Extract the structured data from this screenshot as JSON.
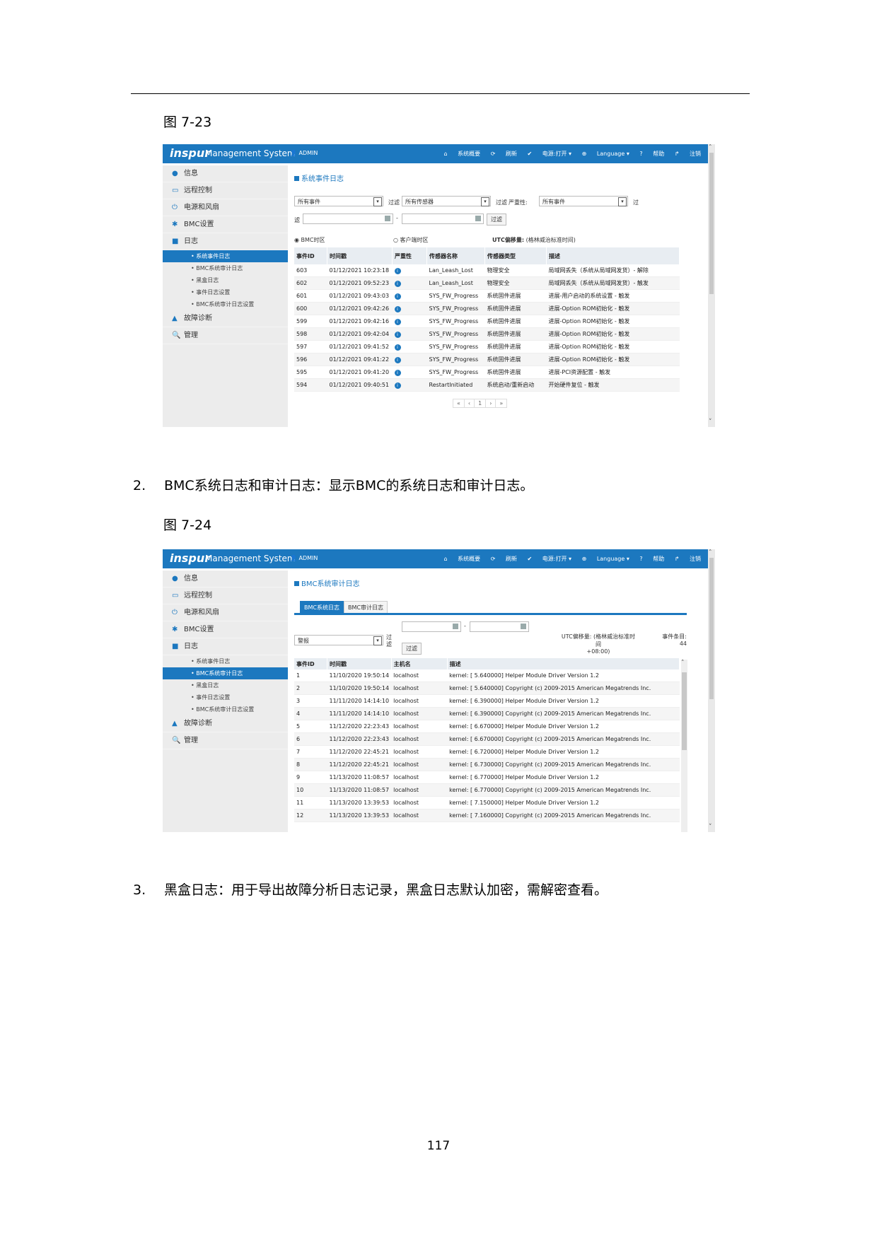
{
  "doc": {
    "fig1_label": "图 7-23",
    "fig2_label": "图 7-24",
    "item2_num": "2.",
    "item2_text": "BMC系统日志和审计日志：显示BMC的系统日志和审计日志。",
    "item3_num": "3.",
    "item3_text": "黑盒日志：用于导出故障分析日志记录，黑盒日志默认加密，需解密查看。",
    "page_number": "117"
  },
  "app": {
    "logo": "inspur",
    "title": "Management System",
    "user": "ADMIN",
    "nav": [
      "系统概要",
      "刷新",
      "电源:打开 ▾",
      "Language ▾",
      "帮助",
      "注销"
    ],
    "sidebar": [
      "信息",
      "远程控制",
      "电源和风扇",
      "BMC设置",
      "日志",
      "故障诊断",
      "管理"
    ],
    "log_subitems": [
      "系统事件日志",
      "BMC系统审计日志",
      "黑盒日志",
      "事件日志设置",
      "BMC系统审计日志设置"
    ]
  },
  "fig1": {
    "section_title": "系统事件日志",
    "filter1": "所有事件",
    "filter_label1": "过滤",
    "filter2": "所有传感器",
    "filter_label2": "过滤",
    "severity_label": "严重性:",
    "filter3": "所有事件",
    "filter_label3": "过",
    "filter_label3b": "滤",
    "dash": "-",
    "filter_button": "过滤",
    "radio1": "BMC时区",
    "radio2": "客户端时区",
    "utc_label": "UTC偏移量:",
    "utc_note": "(格林威治标准时间)",
    "columns": [
      "事件ID",
      "时间戳",
      "严重性",
      "传感器名称",
      "传感器类型",
      "描述"
    ],
    "rows": [
      [
        "603",
        "01/12/2021 10:23:18",
        "i",
        "Lan_Leash_Lost",
        "物理安全",
        "局域网丢失（系统从局域网发货）- 解除"
      ],
      [
        "602",
        "01/12/2021 09:52:23",
        "i",
        "Lan_Leash_Lost",
        "物理安全",
        "局域网丢失（系统从局域网发货）- 触发"
      ],
      [
        "601",
        "01/12/2021 09:43:03",
        "i",
        "SYS_FW_Progress",
        "系统固件进展",
        "进展-用户启动的系统设置 - 触发"
      ],
      [
        "600",
        "01/12/2021 09:42:26",
        "i",
        "SYS_FW_Progress",
        "系统固件进展",
        "进展-Option ROM初始化 - 触发"
      ],
      [
        "599",
        "01/12/2021 09:42:16",
        "i",
        "SYS_FW_Progress",
        "系统固件进展",
        "进展-Option ROM初始化 - 触发"
      ],
      [
        "598",
        "01/12/2021 09:42:04",
        "i",
        "SYS_FW_Progress",
        "系统固件进展",
        "进展-Option ROM初始化 - 触发"
      ],
      [
        "597",
        "01/12/2021 09:41:52",
        "i",
        "SYS_FW_Progress",
        "系统固件进展",
        "进展-Option ROM初始化 - 触发"
      ],
      [
        "596",
        "01/12/2021 09:41:22",
        "i",
        "SYS_FW_Progress",
        "系统固件进展",
        "进展-Option ROM初始化 - 触发"
      ],
      [
        "595",
        "01/12/2021 09:41:20",
        "i",
        "SYS_FW_Progress",
        "系统固件进展",
        "进展-PCI资源配置 - 触发"
      ],
      [
        "594",
        "01/12/2021 09:40:51",
        "i",
        "RestartInitiated",
        "系统启动/重新启动",
        "开始硬件复位 - 触发"
      ]
    ],
    "pager": [
      "«",
      "‹",
      "1",
      "›",
      "»"
    ]
  },
  "fig2": {
    "section_title": "BMC系统审计日志",
    "tab1": "BMC系统日志",
    "tab2": "BMC审计日志",
    "level": "警报",
    "filter_label": "过",
    "filter_label_b": "滤",
    "dash": "-",
    "filter_button": "过滤",
    "utc_text": "UTC偏移量: (格林威治标准时间",
    "utc_value": "+08:00)",
    "count_label": "事件条目:",
    "count_value": "44",
    "columns": [
      "事件ID",
      "时间戳",
      "主机名",
      "描述"
    ],
    "rows": [
      [
        "1",
        "11/10/2020 19:50:14",
        "localhost",
        "kernel: [ 5.640000] Helper Module Driver Version 1.2"
      ],
      [
        "2",
        "11/10/2020 19:50:14",
        "localhost",
        "kernel: [ 5.640000] Copyright (c) 2009-2015 American Megatrends Inc."
      ],
      [
        "3",
        "11/11/2020 14:14:10",
        "localhost",
        "kernel: [ 6.390000] Helper Module Driver Version 1.2"
      ],
      [
        "4",
        "11/11/2020 14:14:10",
        "localhost",
        "kernel: [ 6.390000] Copyright (c) 2009-2015 American Megatrends Inc."
      ],
      [
        "5",
        "11/12/2020 22:23:43",
        "localhost",
        "kernel: [ 6.670000] Helper Module Driver Version 1.2"
      ],
      [
        "6",
        "11/12/2020 22:23:43",
        "localhost",
        "kernel: [ 6.670000] Copyright (c) 2009-2015 American Megatrends Inc."
      ],
      [
        "7",
        "11/12/2020 22:45:21",
        "localhost",
        "kernel: [ 6.720000] Helper Module Driver Version 1.2"
      ],
      [
        "8",
        "11/12/2020 22:45:21",
        "localhost",
        "kernel: [ 6.730000] Copyright (c) 2009-2015 American Megatrends Inc."
      ],
      [
        "9",
        "11/13/2020 11:08:57",
        "localhost",
        "kernel: [ 6.770000] Helper Module Driver Version 1.2"
      ],
      [
        "10",
        "11/13/2020 11:08:57",
        "localhost",
        "kernel: [ 6.770000] Copyright (c) 2009-2015 American Megatrends Inc."
      ],
      [
        "11",
        "11/13/2020 13:39:53",
        "localhost",
        "kernel: [ 7.150000] Helper Module Driver Version 1.2"
      ],
      [
        "12",
        "11/13/2020 13:39:53",
        "localhost",
        "kernel: [ 7.160000] Copyright (c) 2009-2015 American Megatrends Inc."
      ]
    ]
  }
}
